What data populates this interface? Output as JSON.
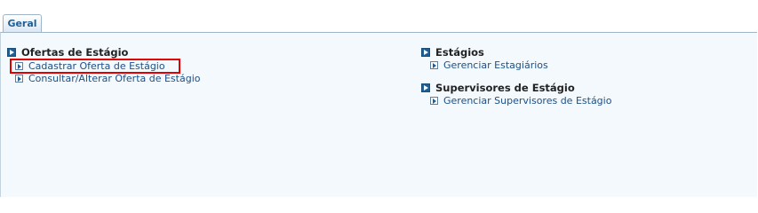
{
  "tabs": [
    {
      "label": "Geral",
      "active": true
    }
  ],
  "colors": {
    "accent": "#1f5f95",
    "link": "#1c4f86",
    "highlight": "#e00000",
    "panel_bg": "#f4f9fd"
  },
  "left_column": {
    "section": {
      "title": "Ofertas de Estágio",
      "icon": "section-arrow-icon",
      "items": [
        {
          "label": "Cadastrar Oferta de Estágio",
          "icon": "link-arrow-icon",
          "highlighted": true
        },
        {
          "label": "Consultar/Alterar Oferta de Estágio",
          "icon": "link-arrow-icon",
          "highlighted": false
        }
      ]
    }
  },
  "right_column": {
    "sections": [
      {
        "title": "Estágios",
        "icon": "section-arrow-icon",
        "items": [
          {
            "label": "Gerenciar Estagiários",
            "icon": "link-arrow-icon"
          }
        ]
      },
      {
        "title": "Supervisores de Estágio",
        "icon": "section-arrow-icon",
        "items": [
          {
            "label": "Gerenciar Supervisores de Estágio",
            "icon": "link-arrow-icon"
          }
        ]
      }
    ]
  }
}
